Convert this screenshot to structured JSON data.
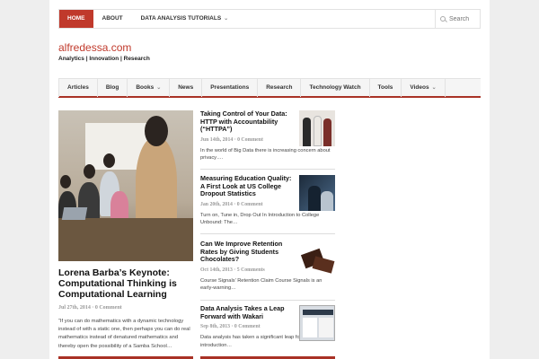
{
  "topnav": {
    "items": [
      {
        "label": "HOME"
      },
      {
        "label": "ABOUT"
      },
      {
        "label": "DATA ANALYSIS TUTORIALS"
      }
    ],
    "search_placeholder": "Search"
  },
  "site": {
    "title": "alfredessa.com",
    "tagline": "Analytics | Innovation | Research"
  },
  "mainnav": {
    "items": [
      {
        "label": "Articles"
      },
      {
        "label": "Blog"
      },
      {
        "label": "Books"
      },
      {
        "label": "News"
      },
      {
        "label": "Presentations"
      },
      {
        "label": "Research"
      },
      {
        "label": "Technology Watch"
      },
      {
        "label": "Tools"
      },
      {
        "label": "Videos"
      }
    ]
  },
  "featured": {
    "title": "Lorena Barba’s Keynote: Computational Thinking is Computational Learning",
    "meta": "Jul 27th, 2014 · 0 Comment",
    "excerpt": "“If you can do mathematics with a dynamic technology instead of with a static one, then perhaps you can do real mathematics instead of denatured mathematics and thereby open the possibility of a Samba School…"
  },
  "articles": [
    {
      "title": "Taking Control of Your Data: HTTP with Accountability (“HTTPA”)",
      "meta": "Jun 14th, 2014 · 0 Comment",
      "excerpt": "In the world of Big Data there is increasing concern about privacy…."
    },
    {
      "title": "Measuring Education Quality: A First Look at US College Dropout Statistics",
      "meta": "Jan 20th, 2014 · 0 Comment",
      "excerpt": "Turn on, Tune in, Drop Out In Introduction to College Unbound: The…"
    },
    {
      "title": "Can We Improve Retention Rates by Giving Students Chocolates?",
      "meta": "Oct 14th, 2013 · 5 Comments",
      "excerpt": "Course Signals’ Retention Claim Course Signals is an early-warning…"
    },
    {
      "title": "Data Analysis Takes a Leap Forward with Wakari",
      "meta": "Sep 8th, 2013 · 0 Comment",
      "excerpt": "Data analysis has taken a significant leap forward with the introduction…"
    }
  ],
  "colors": {
    "accent": "#c0392b",
    "accent_dark": "#a93226"
  }
}
